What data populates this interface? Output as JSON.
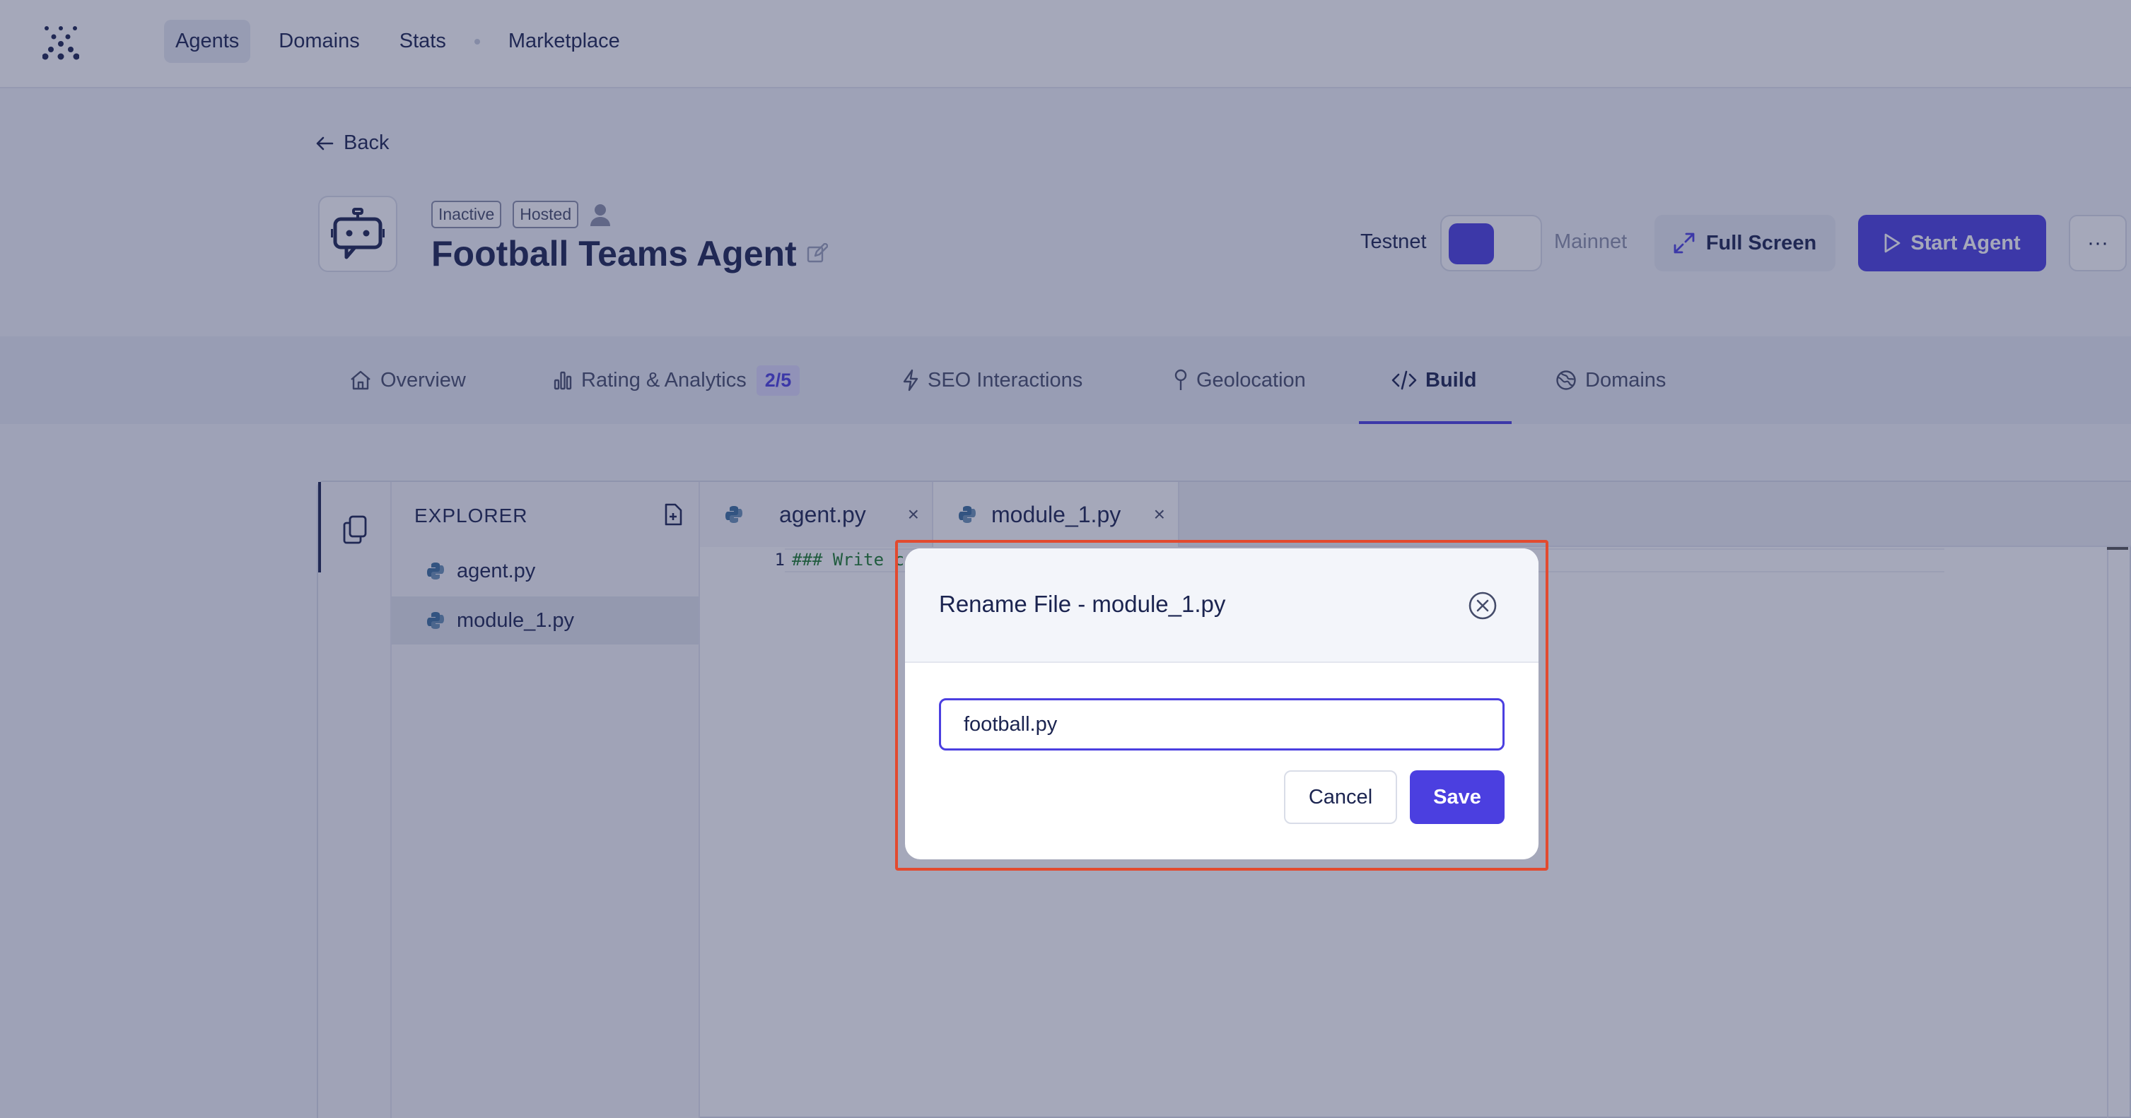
{
  "nav": {
    "items": [
      {
        "label": "Agents",
        "active": true
      },
      {
        "label": "Domains"
      },
      {
        "label": "Stats"
      },
      {
        "label": "Marketplace"
      }
    ]
  },
  "back_label": "Back",
  "agent": {
    "badges": [
      "Inactive",
      "Hosted"
    ],
    "name": "Football Teams Agent"
  },
  "network": {
    "testnet_label": "Testnet",
    "mainnet_label": "Mainnet",
    "selected": "Testnet"
  },
  "actions": {
    "full_screen": "Full Screen",
    "start_agent": "Start Agent",
    "more": "···"
  },
  "tabs": [
    {
      "label": "Overview",
      "icon": "home-icon"
    },
    {
      "label": "Rating & Analytics",
      "icon": "bar-chart-icon",
      "badge": "2/5"
    },
    {
      "label": "SEO Interactions",
      "icon": "lightning-icon"
    },
    {
      "label": "Geolocation",
      "icon": "pin-icon"
    },
    {
      "label": "Build",
      "icon": "code-icon",
      "active": true
    },
    {
      "label": "Domains",
      "icon": "globe-icon"
    }
  ],
  "explorer": {
    "title": "EXPLORER",
    "files": [
      {
        "name": "agent.py"
      },
      {
        "name": "module_1.py",
        "selected": true
      }
    ]
  },
  "editor": {
    "tabs": [
      {
        "name": "agent.py",
        "close": "×"
      },
      {
        "name": "module_1.py",
        "close": "×",
        "active": true
      }
    ],
    "line_number": "1",
    "code_visible": "### Write c"
  },
  "dialog": {
    "title": "Rename File - module_1.py",
    "input_value": "football.py",
    "cancel_label": "Cancel",
    "save_label": "Save"
  },
  "colors": {
    "accent": "#4b3fe0",
    "highlight_border": "#e24a2f",
    "text_primary": "#1b2450"
  }
}
